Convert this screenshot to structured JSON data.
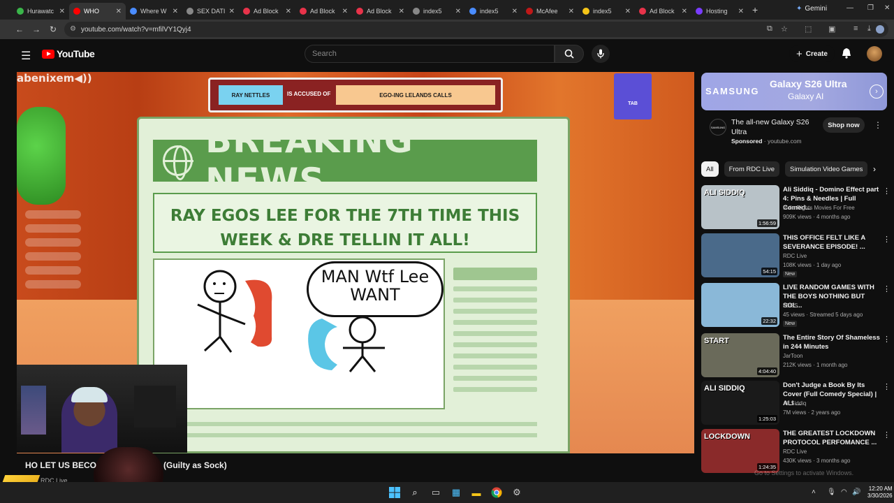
{
  "browser": {
    "tabs": [
      {
        "label": "Hurawatc",
        "color": "#3ab54a"
      },
      {
        "label": "WHO",
        "color": "#ff0000",
        "active": true
      },
      {
        "label": "Where W",
        "color": "#4a8cff"
      },
      {
        "label": "SEX DATI",
        "color": "#888888"
      },
      {
        "label": "Ad Block",
        "color": "#e8334a"
      },
      {
        "label": "Ad Block",
        "color": "#e8334a"
      },
      {
        "label": "Ad Block",
        "color": "#e8334a"
      },
      {
        "label": "index5",
        "color": "#888888"
      },
      {
        "label": "index5",
        "color": "#4a8cff"
      },
      {
        "label": "McAfee",
        "color": "#c01818"
      },
      {
        "label": "index5",
        "color": "#f5c518"
      },
      {
        "label": "Ad Block",
        "color": "#e8334a"
      },
      {
        "label": "Hosting",
        "color": "#7a3cff"
      }
    ],
    "new_tab": "+",
    "gemini_label": "Gemini",
    "url": "youtube.com/watch?v=mfilVY1Qyj4"
  },
  "youtube": {
    "logo_text": "YouTube",
    "search_placeholder": "Search",
    "create_label": "Create"
  },
  "video": {
    "chat_overlay": "abenixem◀))",
    "accused_left": "RAY NETTLES",
    "accused_mid": "IS ACCUSED OF",
    "accused_right": "EGO-ING LELANDS CALLS",
    "tab_key": "TAB",
    "banner": "BREAKING NEWS",
    "headline": "RAY EGOS LEE FOR THE 7TH TIME THIS WEEK & DRE TELLIN IT ALL!",
    "speech_bubble": "MAN Wtf Lee WANT",
    "title_left": "HO LET US BECO",
    "title_right": "(Guilty as Sock)",
    "channel_line": "RDC Live"
  },
  "ad": {
    "brand": "SAMSUNG",
    "product": "Galaxy S26 Ultra",
    "ai_line": "Galaxy AI",
    "headline": "The all-new Galaxy S26 Ultra",
    "sponsored": "Sponsored",
    "domain": "· youtube.com",
    "cta": "Shop now",
    "logo_text": "SAMSUNG"
  },
  "chips": [
    "All",
    "From RDC Live",
    "Simulation Video Games"
  ],
  "videos": [
    {
      "title": "Ali Siddiq - Domino Effect part 4: Pins & Needles | Full Comed...",
      "channel": "Indie Rights Movies For Free",
      "meta": "909K views · 4 months ago",
      "duration": "1:56:59",
      "thumb_text": "ALI SIDDIQ",
      "new": "",
      "thumb_bg": "#b8c2c8"
    },
    {
      "title": "THIS OFFICE FELT LIKE A SEVERANCE EPISODE! ...",
      "channel": "RDC Live",
      "meta": "108K views · 1 day ago",
      "duration": "54:15",
      "thumb_text": "",
      "new": "New",
      "thumb_bg": "#4a6a8a"
    },
    {
      "title": "LIVE RANDOM GAMES WITH THE BOYS NOTHING BUT SOL...",
      "channel": "LEGS",
      "meta": "45 views · Streamed 5 days ago",
      "duration": "22:32",
      "thumb_text": "",
      "new": "New",
      "thumb_bg": "#8ab8d8"
    },
    {
      "title": "The Entire Story Of Shameless in 244 Minutes",
      "channel": "JarToon",
      "meta": "212K views · 1 month ago",
      "duration": "4:04:40",
      "thumb_text": "START",
      "new": "",
      "thumb_bg": "#6a6a5a"
    },
    {
      "title": "Don't Judge a Book By Its Cover (Full Comedy Special) | ALI ...",
      "channel": "Ali Siddiq",
      "meta": "7M views · 2 years ago",
      "duration": "1:25:03",
      "thumb_text": "ALI SIDDIQ",
      "new": "",
      "thumb_bg": "#1a1a1a"
    },
    {
      "title": "THE GREATEST LOCKDOWN PROTOCOL PERFOMANCE ...",
      "channel": "RDC Live",
      "meta": "430K views · 3 months ago",
      "duration": "1:24:35",
      "thumb_text": "LOCKDOWN",
      "new": "",
      "thumb_bg": "#8a2a2a"
    }
  ],
  "watermark": "Go to Settings to activate Windows.",
  "taskbar": {
    "time": "12:20 AM",
    "date": "3/30/2026"
  }
}
